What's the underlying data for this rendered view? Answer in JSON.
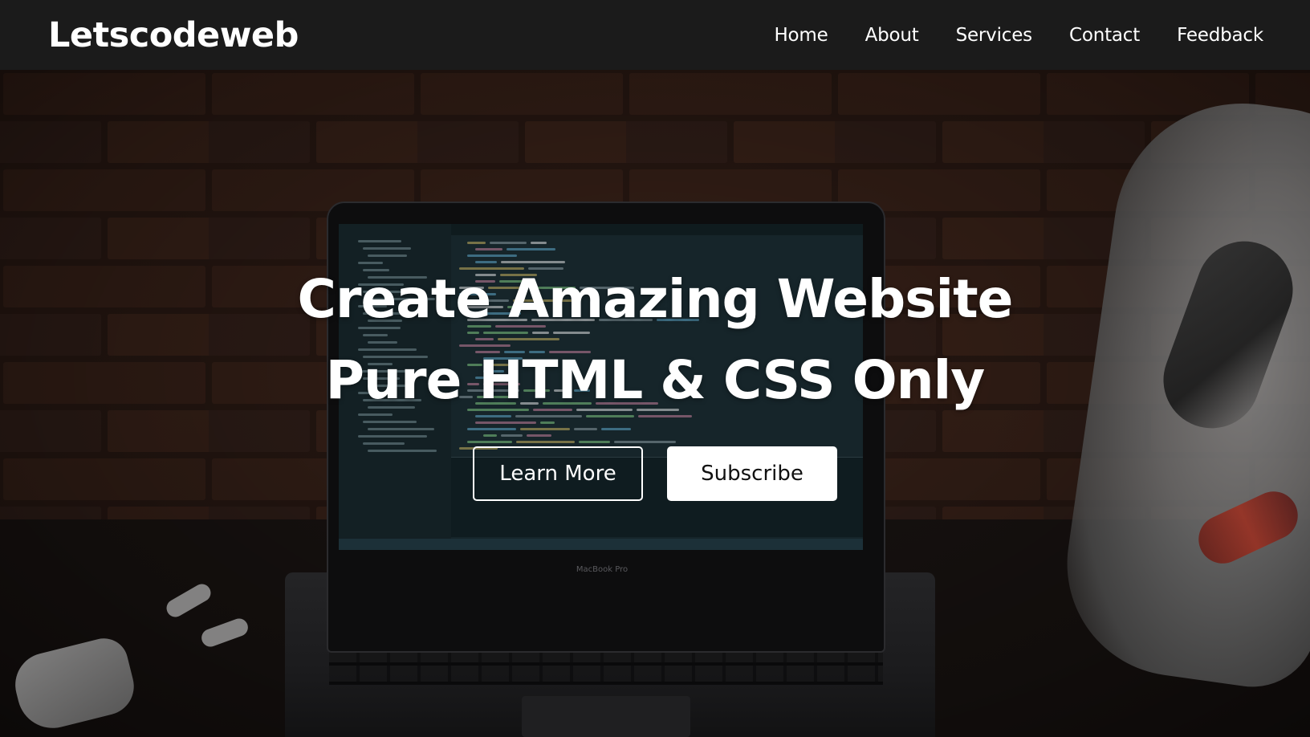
{
  "navbar": {
    "logo": "Letscodeweb",
    "links": [
      {
        "label": "Home"
      },
      {
        "label": "About"
      },
      {
        "label": "Services"
      },
      {
        "label": "Contact"
      },
      {
        "label": "Feedback"
      }
    ]
  },
  "hero": {
    "headline_line1": "Create Amazing Website",
    "headline_line2": "Pure HTML & CSS Only",
    "primary_button": "Learn More",
    "secondary_button": "Subscribe"
  },
  "background": {
    "laptop_label": "MacBook Pro"
  },
  "colors": {
    "navbar_bg": "#1b1b1b",
    "text": "#ffffff",
    "button_solid_bg": "#ffffff",
    "button_solid_text": "#111111"
  }
}
